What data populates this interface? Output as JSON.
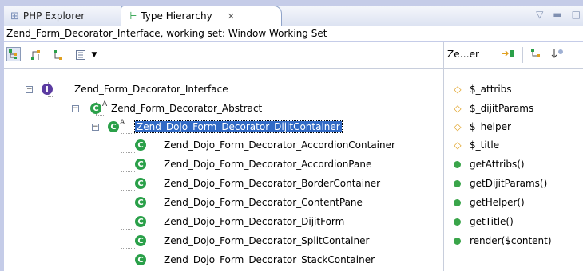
{
  "tabs": [
    {
      "label": "PHP Explorer",
      "icon": "php-explorer-icon",
      "active": false
    },
    {
      "label": "Type Hierarchy",
      "icon": "type-hierarchy-icon",
      "active": true,
      "close": "✕"
    }
  ],
  "view_title": "Zend_Form_Decorator_Interface, working set: Window Working Set",
  "right_toolbar": {
    "label": "Ze…er"
  },
  "tree": {
    "interface": {
      "label": "Zend_Form_Decorator_Interface",
      "icon_letter": "I"
    },
    "abstract": {
      "label": "Zend_Form_Decorator_Abstract",
      "icon_letter": "C",
      "modifier": "A"
    },
    "selected": {
      "label": "Zend_Dojo_Form_Decorator_DijitContainer",
      "icon_letter": "C",
      "modifier": "A"
    },
    "children": [
      {
        "label": "Zend_Dojo_Form_Decorator_AccordionContainer"
      },
      {
        "label": "Zend_Dojo_Form_Decorator_AccordionPane"
      },
      {
        "label": "Zend_Dojo_Form_Decorator_BorderContainer"
      },
      {
        "label": "Zend_Dojo_Form_Decorator_ContentPane"
      },
      {
        "label": "Zend_Dojo_Form_Decorator_DijitForm"
      },
      {
        "label": "Zend_Dojo_Form_Decorator_SplitContainer"
      },
      {
        "label": "Zend_Dojo_Form_Decorator_StackContainer"
      }
    ]
  },
  "members": [
    {
      "label": "$_attribs",
      "kind": "field"
    },
    {
      "label": "$_dijitParams",
      "kind": "field"
    },
    {
      "label": "$_helper",
      "kind": "field"
    },
    {
      "label": "$_title",
      "kind": "field"
    },
    {
      "label": "getAttribs()",
      "kind": "method"
    },
    {
      "label": "getDijitParams()",
      "kind": "method"
    },
    {
      "label": "getHelper()",
      "kind": "method"
    },
    {
      "label": "getTitle()",
      "kind": "method"
    },
    {
      "label": "render($content)",
      "kind": "method"
    }
  ],
  "colors": {
    "selection": "#316ac5",
    "class_icon": "#2aa049",
    "interface_icon": "#5b3ba1",
    "field_icon": "#e0a020"
  }
}
